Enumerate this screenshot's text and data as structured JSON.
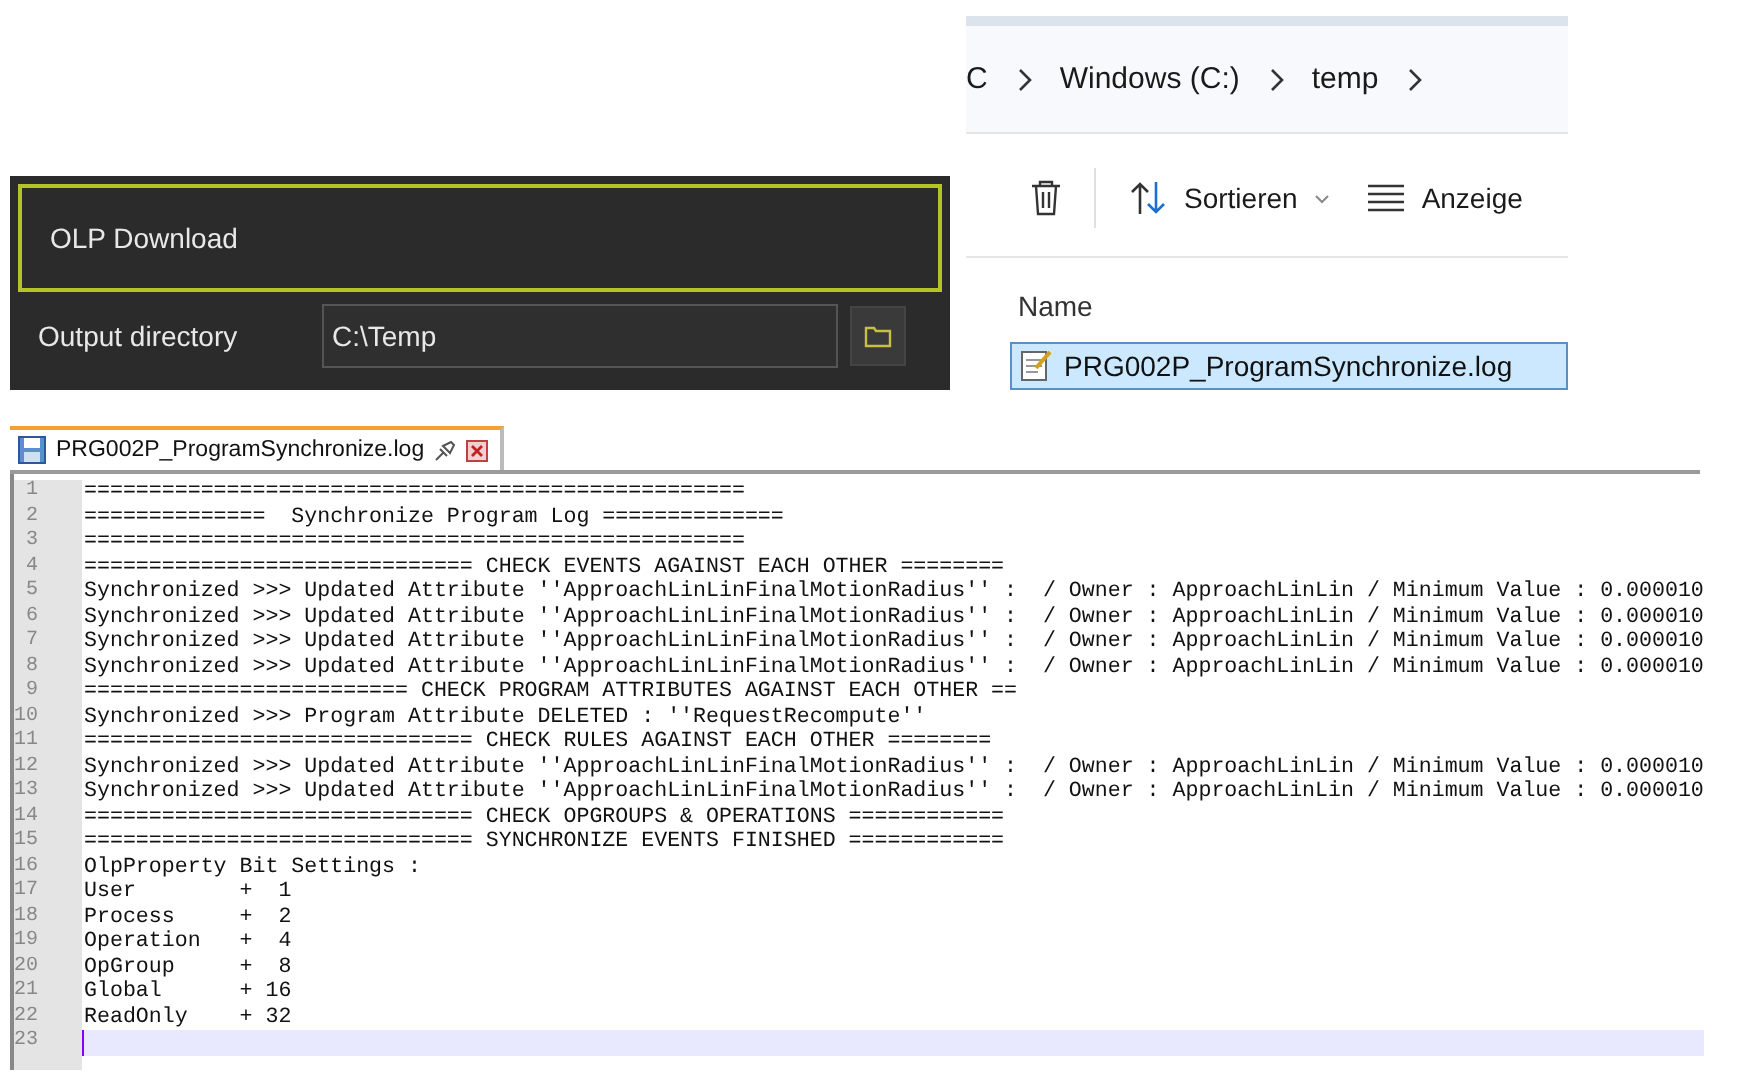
{
  "olp_panel": {
    "title": "OLP Download",
    "output_label": "Output directory",
    "output_value": "C:\\Temp"
  },
  "explorer": {
    "breadcrumb": [
      "C",
      "Windows (C:)",
      "temp"
    ],
    "toolbar": [
      {
        "kind": "delete"
      },
      {
        "kind": "sort",
        "label": "Sortieren"
      },
      {
        "kind": "view",
        "label": "Anzeige"
      }
    ],
    "column": "Name",
    "files": [
      {
        "name": "PRG002P_ProgramSynchronize.log",
        "selected": true
      }
    ]
  },
  "editor": {
    "tab": {
      "title": "PRG002P_ProgramSynchronize.log",
      "selected": true
    },
    "lines": [
      {
        "number": "1",
        "text": "===================================================",
        "current": false
      },
      {
        "number": "2",
        "text": "==============  Synchronize Program Log ==============",
        "current": false
      },
      {
        "number": "3",
        "text": "===================================================",
        "current": false
      },
      {
        "number": "4",
        "text": "============================== CHECK EVENTS AGAINST EACH OTHER ========",
        "current": false
      },
      {
        "number": "5",
        "text": "Synchronized >>> Updated Attribute ''ApproachLinLinFinalMotionRadius'' :  / Owner : ApproachLinLin / Minimum Value : 0.000010",
        "current": false
      },
      {
        "number": "6",
        "text": "Synchronized >>> Updated Attribute ''ApproachLinLinFinalMotionRadius'' :  / Owner : ApproachLinLin / Minimum Value : 0.000010",
        "current": false
      },
      {
        "number": "7",
        "text": "Synchronized >>> Updated Attribute ''ApproachLinLinFinalMotionRadius'' :  / Owner : ApproachLinLin / Minimum Value : 0.000010",
        "current": false
      },
      {
        "number": "8",
        "text": "Synchronized >>> Updated Attribute ''ApproachLinLinFinalMotionRadius'' :  / Owner : ApproachLinLin / Minimum Value : 0.000010",
        "current": false
      },
      {
        "number": "9",
        "text": "========================= CHECK PROGRAM ATTRIBUTES AGAINST EACH OTHER ==",
        "current": false
      },
      {
        "number": "10",
        "text": "Synchronized >>> Program Attribute DELETED : ''RequestRecompute''",
        "current": false
      },
      {
        "number": "11",
        "text": "============================== CHECK RULES AGAINST EACH OTHER ========",
        "current": false
      },
      {
        "number": "12",
        "text": "Synchronized >>> Updated Attribute ''ApproachLinLinFinalMotionRadius'' :  / Owner : ApproachLinLin / Minimum Value : 0.000010",
        "current": false
      },
      {
        "number": "13",
        "text": "Synchronized >>> Updated Attribute ''ApproachLinLinFinalMotionRadius'' :  / Owner : ApproachLinLin / Minimum Value : 0.000010",
        "current": false
      },
      {
        "number": "14",
        "text": "============================== CHECK OPGROUPS & OPERATIONS ============",
        "current": false
      },
      {
        "number": "15",
        "text": "============================== SYNCHRONIZE EVENTS FINISHED ============",
        "current": false
      },
      {
        "number": "16",
        "text": "OlpProperty Bit Settings :",
        "current": false
      },
      {
        "number": "17",
        "text": "User        +  1",
        "current": false
      },
      {
        "number": "18",
        "text": "Process     +  2",
        "current": false
      },
      {
        "number": "19",
        "text": "Operation   +  4",
        "current": false
      },
      {
        "number": "20",
        "text": "OpGroup     +  8",
        "current": false
      },
      {
        "number": "21",
        "text": "Global      + 16",
        "current": false
      },
      {
        "number": "22",
        "text": "ReadOnly    + 32",
        "current": false
      },
      {
        "number": "23",
        "current": true
      }
    ]
  }
}
